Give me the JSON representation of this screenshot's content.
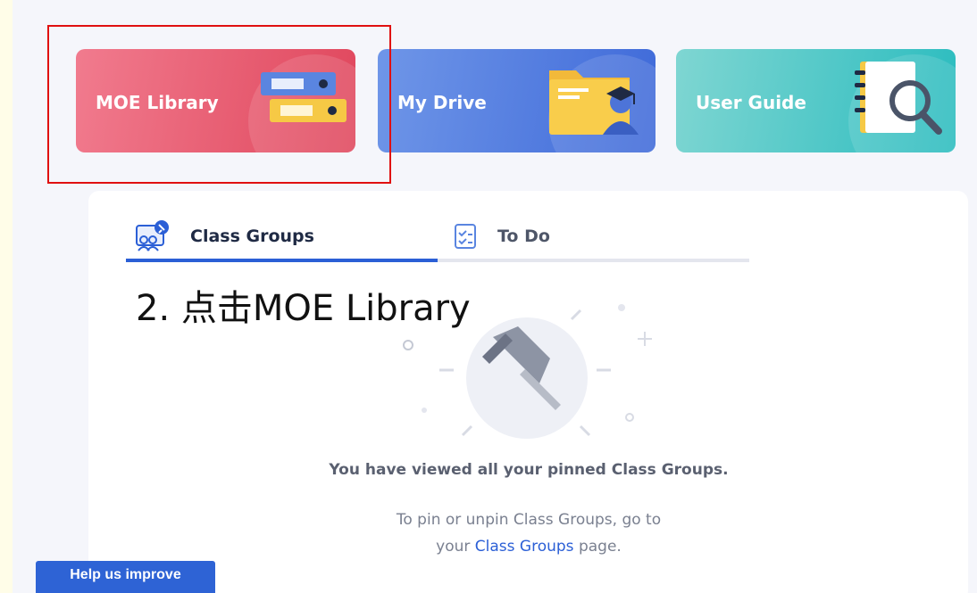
{
  "tiles": {
    "moe_library": "MOE Library",
    "my_drive": "My Drive",
    "user_guide": "User Guide"
  },
  "tabs": {
    "class_groups": "Class Groups",
    "to_do": "To Do"
  },
  "annotation": "2. 点击MOE Library",
  "empty_state": {
    "title": "You have viewed all your pinned Class Groups.",
    "line1": "To pin or unpin Class Groups, go to",
    "line2_prefix": "your ",
    "line2_link": "Class Groups",
    "line2_suffix": " page."
  },
  "help_button": "Help us improve",
  "colors": {
    "moe_tile": "#e0475d",
    "drive_tile": "#3f6ad9",
    "guide_tile": "#2bbcbf",
    "accent": "#2b5fd6",
    "highlight_box": "#e01010"
  },
  "icons": {
    "moe": "binders-icon",
    "drive": "folder-graduate-icon",
    "guide": "notebook-magnifier-icon",
    "class_groups": "class-groups-pin-icon",
    "to_do": "checklist-icon",
    "empty": "pushpin-illustration"
  }
}
